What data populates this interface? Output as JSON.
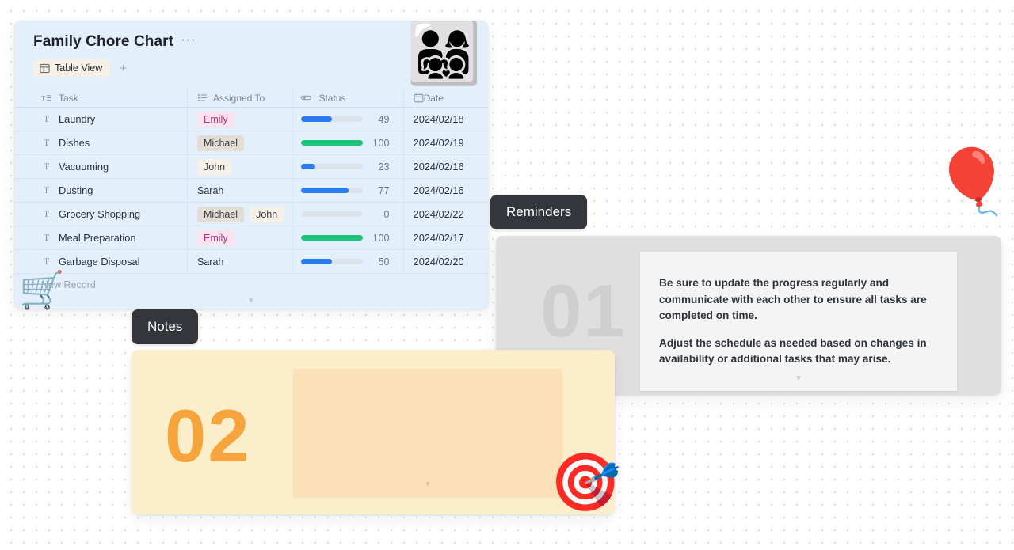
{
  "table_card": {
    "title": "Family Chore Chart",
    "more_label": "···",
    "tab_label": "Table View",
    "add_tab_label": "+",
    "header_emoji": "👨‍👩‍👧‍👦",
    "columns": [
      {
        "label": "Task",
        "icon": "text-list-icon"
      },
      {
        "label": "Assigned To",
        "icon": "multi-select-icon"
      },
      {
        "label": "Status",
        "icon": "progress-icon"
      },
      {
        "label": "Date",
        "icon": "calendar-icon"
      }
    ],
    "rows": [
      {
        "task": "Laundry",
        "assignees": [
          {
            "name": "Emily",
            "style": "pink"
          }
        ],
        "progress": 49,
        "progress_label": "49",
        "date": "2024/02/18"
      },
      {
        "task": "Dishes",
        "assignees": [
          {
            "name": "Michael",
            "style": "gray"
          }
        ],
        "progress": 100,
        "progress_label": "100",
        "date": "2024/02/19"
      },
      {
        "task": "Vacuuming",
        "assignees": [
          {
            "name": "John",
            "style": "cream"
          }
        ],
        "progress": 23,
        "progress_label": "23",
        "date": "2024/02/16"
      },
      {
        "task": "Dusting",
        "assignees": [
          {
            "name": "Sarah",
            "style": "none"
          }
        ],
        "progress": 77,
        "progress_label": "77",
        "date": "2024/02/16"
      },
      {
        "task": "Grocery Shopping",
        "assignees": [
          {
            "name": "Michael",
            "style": "gray"
          },
          {
            "name": "John",
            "style": "cream"
          }
        ],
        "progress": 0,
        "progress_label": "0",
        "date": "2024/02/22"
      },
      {
        "task": "Meal Preparation",
        "assignees": [
          {
            "name": "Emily",
            "style": "pink"
          }
        ],
        "progress": 100,
        "progress_label": "100",
        "date": "2024/02/17"
      },
      {
        "task": "Garbage Disposal",
        "assignees": [
          {
            "name": "Sarah",
            "style": "none"
          }
        ],
        "progress": 50,
        "progress_label": "50",
        "date": "2024/02/20"
      }
    ],
    "new_record_label": "New Record"
  },
  "reminders": {
    "badge_label": "Reminders",
    "number": "01",
    "paragraphs": [
      "Be sure to update the progress regularly and communicate with each other to ensure all tasks are completed on time.",
      "Adjust the schedule as needed based on changes in availability or additional tasks that may arise."
    ]
  },
  "notes": {
    "badge_label": "Notes",
    "number": "02"
  },
  "decorations": {
    "balloon": "🎈",
    "cart": "🛒",
    "target": "🎯"
  },
  "colors": {
    "progress_blue": "#2b7cf0",
    "progress_green": "#1ec47d",
    "progress_track": "#dde3ea",
    "table_bg": "#e3effc",
    "notes_accent": "#f5a53c",
    "badge_bg": "#35363b"
  }
}
